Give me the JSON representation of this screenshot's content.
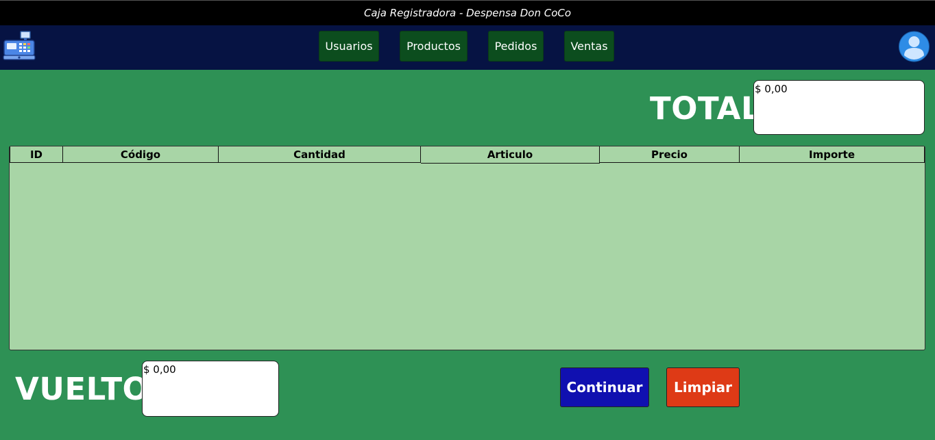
{
  "window": {
    "title": "Caja Registradora - Despensa Don CoCo"
  },
  "nav": {
    "logo_icon": "cash-register-icon",
    "items": [
      {
        "label": "Usuarios"
      },
      {
        "label": "Productos"
      },
      {
        "label": "Pedidos"
      },
      {
        "label": "Ventas"
      }
    ],
    "avatar_icon": "user-avatar-icon"
  },
  "total": {
    "label": "TOTAL",
    "value": "$ 0,00"
  },
  "table": {
    "columns": [
      "ID",
      "Código",
      "Cantidad",
      "Articulo",
      "Precio",
      "Importe"
    ],
    "rows": []
  },
  "vuelto": {
    "label": "VUELTO",
    "value": "$ 0,00"
  },
  "actions": {
    "continuar_label": "Continuar",
    "limpiar_label": "Limpiar"
  },
  "colors": {
    "background": "#2e9155",
    "navbar": "#061343",
    "nav_button": "#0c4d1e",
    "table_bg": "#a8d5a6",
    "continuar": "#1010b0",
    "limpiar": "#de3a16"
  }
}
